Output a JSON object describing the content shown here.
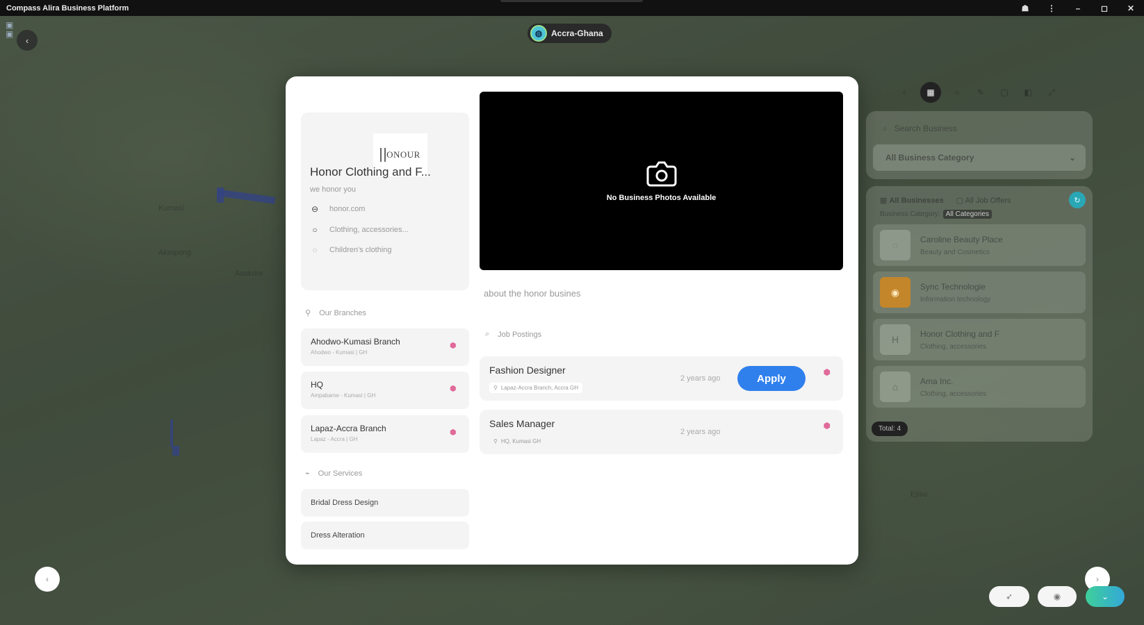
{
  "window": {
    "title": "Compass Alira Business Platform",
    "controls": [
      "☗",
      "⋮",
      "–",
      "◻",
      "✕"
    ]
  },
  "map": {
    "labels": [
      "Kumasi",
      "Akropong",
      "Asokore",
      "Ejisu"
    ]
  },
  "location": {
    "label": "Accra-Ghana"
  },
  "right_panel": {
    "search_placeholder": "Search Business",
    "category_select": "All Business Category",
    "tabs": {
      "all": "All Businesses",
      "jobs": "All Job Offers"
    },
    "filter_label": "Business Category:",
    "filter_chip": "All Categories",
    "businesses": [
      {
        "name": "Caroline Beauty Place",
        "category": "Beauty and Cosmetics"
      },
      {
        "name": "Sync Technologie",
        "category": "Information technology"
      },
      {
        "name": "Honor Clothing and F",
        "category": "Clothing, accessories"
      },
      {
        "name": "Ama Inc.",
        "category": "Clothing, accessories"
      }
    ],
    "total": "Total: 4"
  },
  "modal": {
    "logo_text": "ONOUR",
    "business_name": "Honor Clothing and F...",
    "tagline": "we honor you",
    "website": "honor.com",
    "category": "Clothing, accessories...",
    "subcategory": "Children's clothing",
    "branches_label": "Our Branches",
    "branches": [
      {
        "name": "Ahodwo-Kumasi Branch",
        "sub": "Ahodwo - Kumasi | GH"
      },
      {
        "name": "HQ",
        "sub": "Ampabame - Kumasi | GH"
      },
      {
        "name": "Lapaz-Accra Branch",
        "sub": "Lapaz - Accra | GH"
      }
    ],
    "services_label": "Our Services",
    "services": [
      "Bridal Dress Design",
      "Dress Alteration"
    ],
    "no_photos": "No Business Photos Available",
    "about": "about the honor busines",
    "job_search_label": "Job Postings",
    "jobs": [
      {
        "title": "Fashion Designer",
        "location": "Lapaz-Accra Branch, Accra GH",
        "ago": "2 years ago",
        "apply": "Apply"
      },
      {
        "title": "Sales Manager",
        "location": "HQ, Kumasi GH",
        "ago": "2 years ago"
      }
    ]
  }
}
